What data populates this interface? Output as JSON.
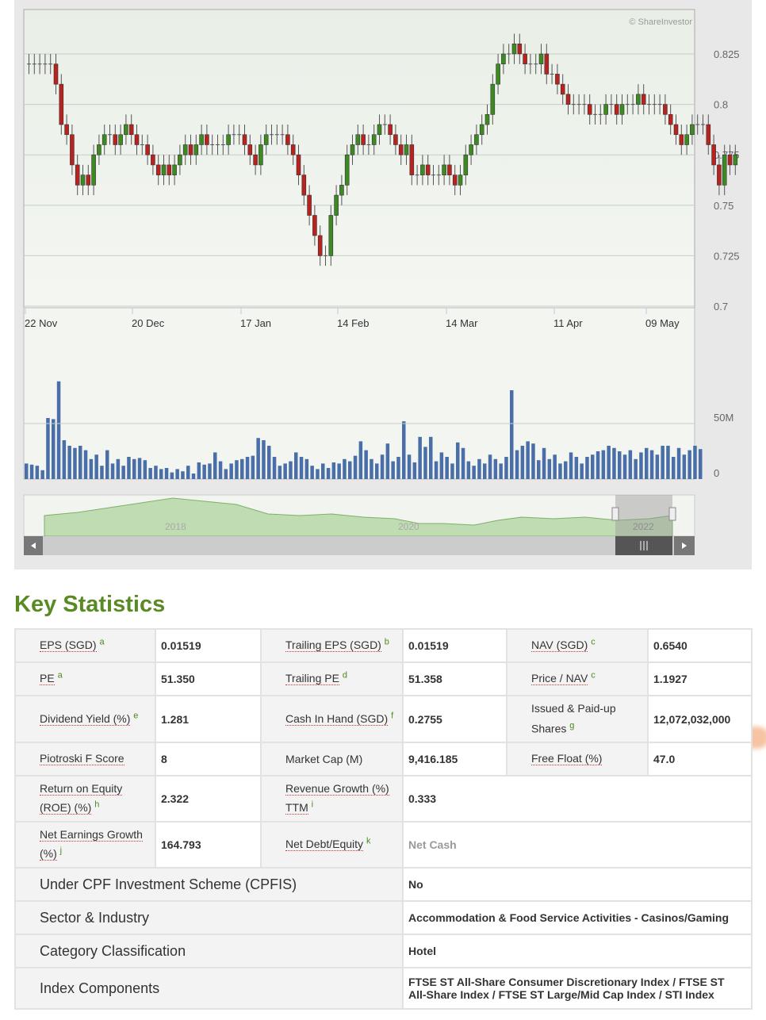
{
  "chart": {
    "credit": "© ShareInvestor",
    "y_ticks": [
      "0.825",
      "0.8",
      "0.775",
      "0.75",
      "0.725",
      "0.7"
    ],
    "y_values": [
      0.825,
      0.8,
      0.775,
      0.75,
      0.725,
      0.7
    ],
    "x_labels": [
      "22 Nov",
      "20 Dec",
      "17 Jan",
      "14 Feb",
      "14 Mar",
      "11 Apr",
      "09 May"
    ],
    "vol_ticks": [
      "50M",
      "0"
    ],
    "nav_years": [
      "2018",
      "2020",
      "2022"
    ],
    "up_color": "#3d8a22",
    "down_color": "#b8221f",
    "volume_color": "#4a6fa8",
    "closes": [
      0.82,
      0.82,
      0.82,
      0.82,
      0.82,
      0.81,
      0.79,
      0.785,
      0.77,
      0.76,
      0.765,
      0.76,
      0.775,
      0.78,
      0.785,
      0.785,
      0.78,
      0.785,
      0.79,
      0.785,
      0.78,
      0.78,
      0.775,
      0.77,
      0.765,
      0.77,
      0.765,
      0.77,
      0.775,
      0.78,
      0.775,
      0.78,
      0.785,
      0.78,
      0.78,
      0.78,
      0.78,
      0.785,
      0.785,
      0.785,
      0.78,
      0.775,
      0.77,
      0.78,
      0.785,
      0.785,
      0.785,
      0.785,
      0.78,
      0.775,
      0.765,
      0.755,
      0.745,
      0.735,
      0.725,
      0.725,
      0.745,
      0.755,
      0.76,
      0.775,
      0.78,
      0.785,
      0.78,
      0.78,
      0.785,
      0.79,
      0.79,
      0.785,
      0.78,
      0.775,
      0.78,
      0.765,
      0.765,
      0.77,
      0.765,
      0.765,
      0.765,
      0.77,
      0.765,
      0.76,
      0.765,
      0.775,
      0.78,
      0.785,
      0.79,
      0.795,
      0.81,
      0.82,
      0.825,
      0.825,
      0.83,
      0.825,
      0.82,
      0.82,
      0.82,
      0.825,
      0.815,
      0.815,
      0.81,
      0.805,
      0.8,
      0.8,
      0.8,
      0.8,
      0.795,
      0.795,
      0.795,
      0.8,
      0.8,
      0.795,
      0.8,
      0.8,
      0.8,
      0.805,
      0.8,
      0.8,
      0.8,
      0.8,
      0.795,
      0.79,
      0.785,
      0.78,
      0.785,
      0.79,
      0.79,
      0.79,
      0.78,
      0.77,
      0.76,
      0.775,
      0.77,
      0.775
    ],
    "volumes_m": [
      14,
      13,
      12,
      8,
      55,
      54,
      88,
      35,
      30,
      28,
      30,
      26,
      18,
      22,
      12,
      26,
      14,
      18,
      12,
      20,
      18,
      19,
      17,
      10,
      12,
      9,
      10,
      6,
      9,
      7,
      12,
      5,
      15,
      13,
      14,
      24,
      16,
      9,
      14,
      17,
      18,
      20,
      21,
      37,
      35,
      30,
      20,
      12,
      14,
      16,
      24,
      20,
      18,
      12,
      9,
      14,
      10,
      15,
      14,
      18,
      16,
      21,
      34,
      26,
      18,
      14,
      22,
      32,
      16,
      20,
      52,
      22,
      15,
      38,
      29,
      38,
      16,
      24,
      20,
      14,
      33,
      28,
      16,
      12,
      18,
      14,
      22,
      18,
      14,
      20,
      80,
      26,
      30,
      34,
      32,
      17,
      28,
      18,
      22,
      14,
      16,
      24,
      20,
      14,
      20,
      22,
      25,
      26,
      30,
      28,
      25,
      22,
      26,
      18,
      24,
      28,
      26,
      22,
      30,
      30,
      20,
      28,
      22,
      26,
      30,
      27
    ]
  },
  "title": "Key Statistics",
  "stats": {
    "eps_l": "EPS (SGD)",
    "eps_s": "a",
    "eps_v": "0.01519",
    "teps_l": "Trailing EPS (SGD)",
    "teps_s": "b",
    "teps_v": "0.01519",
    "nav_l": "NAV (SGD)",
    "nav_s": "c",
    "nav_v": "0.6540",
    "pe_l": "PE",
    "pe_s": "a",
    "pe_v": "51.350",
    "tpe_l": "Trailing PE",
    "tpe_s": "d",
    "tpe_v": "51.358",
    "pnav_l": "Price / NAV",
    "pnav_s": "c",
    "pnav_v": "1.1927",
    "dy_l": "Dividend Yield (%)",
    "dy_s": "e",
    "dy_v": "1.281",
    "cash_l": "Cash In Hand (SGD)",
    "cash_s": "f",
    "cash_v": "0.2755",
    "sh_l": "Issued & Paid-up Shares",
    "sh_s": "g",
    "sh_v": "12,072,032,000",
    "pf_l": "Piotroski F Score",
    "pf_v": "8",
    "mc_l": "Market Cap (M)",
    "mc_v": "9,416.185",
    "ff_l": "Free Float (%)",
    "ff_v": "47.0",
    "roe_l": "Return on Equity (ROE) (%)",
    "roe_s": "h",
    "roe_v": "2.322",
    "rg_l": "Revenue Growth (%) TTM",
    "rg_s": "i",
    "rg_v": "0.333",
    "neg_l": "Net Earnings Growth (%)",
    "neg_s": "j",
    "neg_v": "164.793",
    "nde_l": "Net Debt/Equity",
    "nde_s": "k",
    "nde_v": "Net Cash",
    "cpf_l": "Under CPF Investment Scheme (CPFIS)",
    "cpf_v": "No",
    "sec_l": "Sector & Industry",
    "sec_v": "Accommodation & Food Service Activities - Casinos/Gaming",
    "cat_l": "Category Classification",
    "cat_v": "Hotel",
    "idx_l": "Index Components",
    "idx_v": "FTSE ST All-Share Consumer Discretionary Index / FTSE ST All-Share Index / FTSE ST Large/Mid Cap Index / STI Index"
  }
}
